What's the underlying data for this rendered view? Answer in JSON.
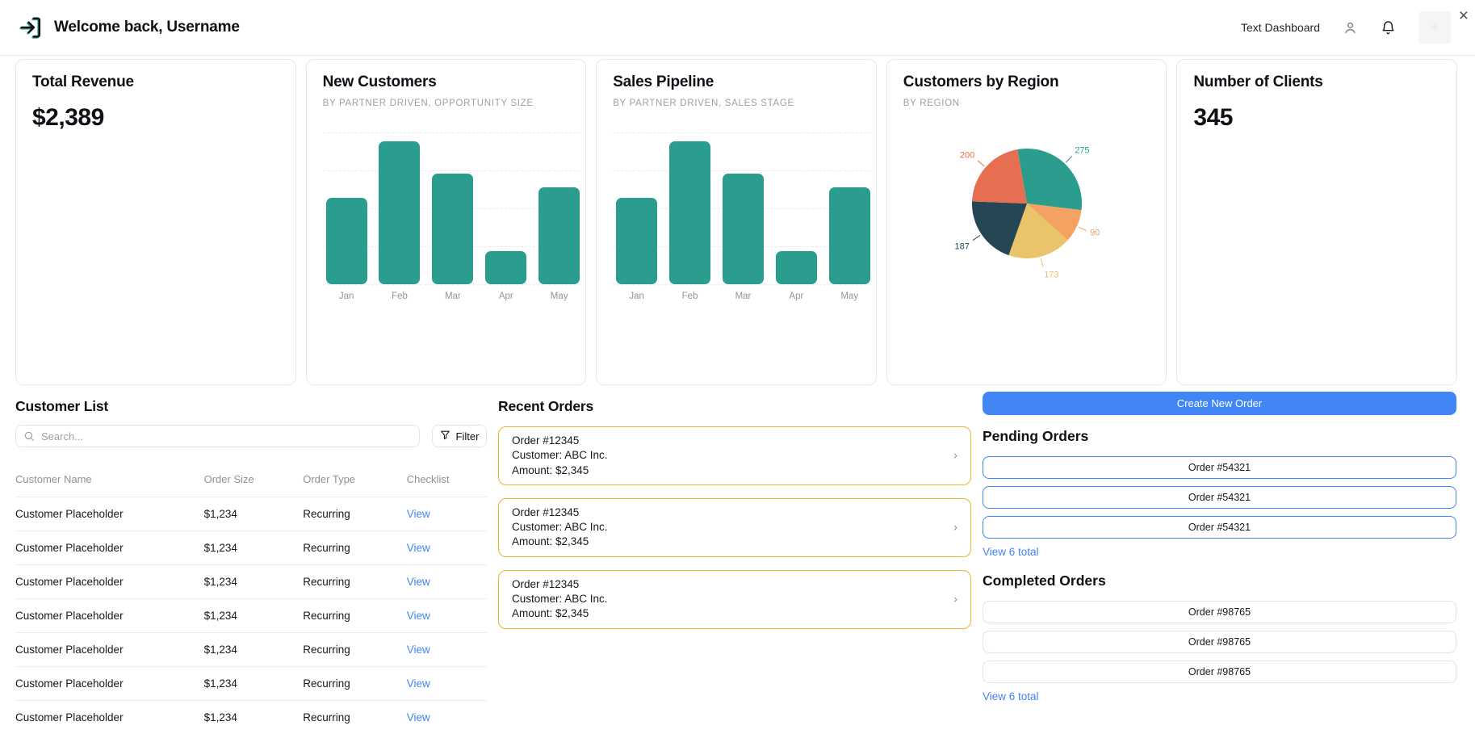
{
  "header": {
    "title": "Welcome back, Username",
    "nav_label": "Text Dashboard",
    "close_label": "×"
  },
  "colors": {
    "teal": "#2a9d8f",
    "blue": "#4285f4",
    "amber": "#f0b429",
    "navy": "#264653",
    "yellow": "#e9c46a",
    "salmon": "#e76f51",
    "light_orange": "#f4a261"
  },
  "cards": {
    "total_revenue": {
      "title": "Total Revenue",
      "value": "$2,389"
    },
    "new_customers": {
      "title": "New Customers",
      "subtitle": "BY PARTNER DRIVEN, OPPORTUNITY SIZE"
    },
    "sales_pipeline": {
      "title": "Sales Pipeline",
      "subtitle": "BY PARTNER DRIVEN, SALES STAGE"
    },
    "customers_by_region": {
      "title": "Customers by Region",
      "subtitle": "BY REGION"
    },
    "number_of_clients": {
      "title": "Number of Clients",
      "value": "345"
    }
  },
  "chart_data": [
    {
      "type": "bar",
      "title": "New Customers",
      "subtitle": "BY PARTNER DRIVEN, OPPORTUNITY SIZE",
      "categories": [
        "Jan",
        "Feb",
        "Mar",
        "Apr",
        "May"
      ],
      "values": [
        57,
        94,
        73,
        22,
        64
      ],
      "ylim": [
        0,
        100
      ],
      "grid": true,
      "bar_color": "#2a9d8f",
      "xlabel": "",
      "ylabel": ""
    },
    {
      "type": "bar",
      "title": "Sales Pipeline",
      "subtitle": "BY PARTNER DRIVEN, SALES STAGE",
      "categories": [
        "Jan",
        "Feb",
        "Mar",
        "Apr",
        "May"
      ],
      "values": [
        57,
        94,
        73,
        22,
        64
      ],
      "ylim": [
        0,
        100
      ],
      "grid": true,
      "bar_color": "#2a9d8f",
      "xlabel": "",
      "ylabel": ""
    },
    {
      "type": "pie",
      "title": "Customers by Region",
      "subtitle": "BY REGION",
      "values": [
        275,
        90,
        173,
        187,
        200
      ],
      "labels": [
        "275",
        "90",
        "173",
        "187",
        "200"
      ],
      "colors": [
        "#2a9d8f",
        "#f4a261",
        "#e9c46a",
        "#264653",
        "#e76f51"
      ],
      "start_angle": -10,
      "legend": "none"
    }
  ],
  "customer_list": {
    "heading": "Customer List",
    "search_placeholder": "Search...",
    "filter_label": "Filter",
    "columns": [
      "Customer Name",
      "Order Size",
      "Order Type",
      "Checklist"
    ],
    "rows": [
      {
        "name": "Customer Placeholder",
        "order_size": "$1,234",
        "order_type": "Recurring",
        "action": "View"
      },
      {
        "name": "Customer Placeholder",
        "order_size": "$1,234",
        "order_type": "Recurring",
        "action": "View"
      },
      {
        "name": "Customer Placeholder",
        "order_size": "$1,234",
        "order_type": "Recurring",
        "action": "View"
      },
      {
        "name": "Customer Placeholder",
        "order_size": "$1,234",
        "order_type": "Recurring",
        "action": "View"
      },
      {
        "name": "Customer Placeholder",
        "order_size": "$1,234",
        "order_type": "Recurring",
        "action": "View"
      },
      {
        "name": "Customer Placeholder",
        "order_size": "$1,234",
        "order_type": "Recurring",
        "action": "View"
      },
      {
        "name": "Customer Placeholder",
        "order_size": "$1,234",
        "order_type": "Recurring",
        "action": "View"
      }
    ]
  },
  "recent_orders": {
    "heading": "Recent Orders",
    "items": [
      {
        "order": "Order #12345",
        "customer": "Customer: ABC Inc.",
        "amount": "Amount: $2,345"
      },
      {
        "order": "Order #12345",
        "customer": "Customer: ABC Inc.",
        "amount": "Amount: $2,345"
      },
      {
        "order": "Order #12345",
        "customer": "Customer: ABC Inc.",
        "amount": "Amount: $2,345"
      }
    ]
  },
  "orders_panel": {
    "create_button": "Create New Order",
    "pending": {
      "heading": "Pending Orders",
      "items": [
        "Order #54321",
        "Order #54321",
        "Order #54321"
      ],
      "view_link": "View 6 total"
    },
    "completed": {
      "heading": "Completed Orders",
      "items": [
        "Order #98765",
        "Order #98765",
        "Order #98765"
      ],
      "view_link": "View 6 total"
    }
  }
}
